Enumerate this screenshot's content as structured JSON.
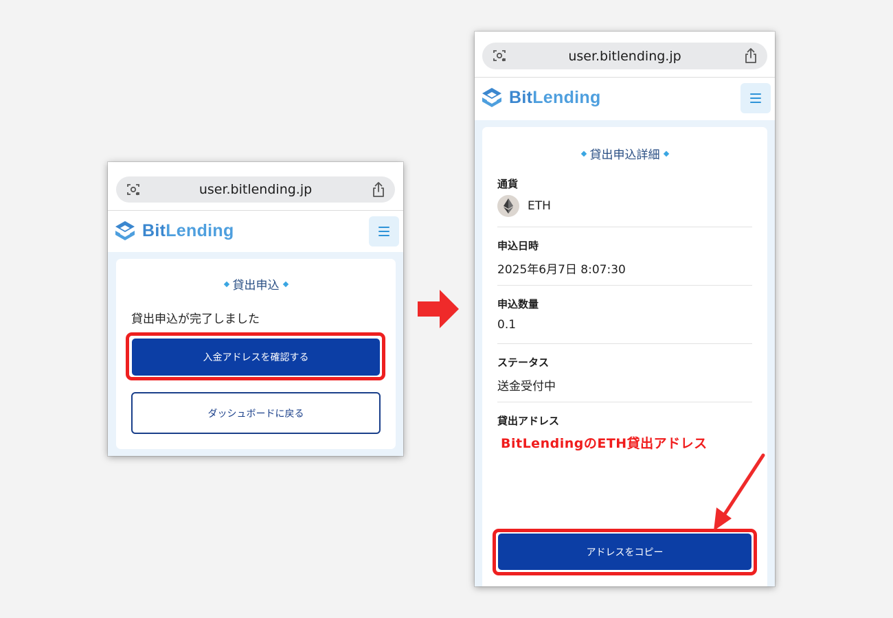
{
  "left_phone": {
    "browser": {
      "url": "user.bitlending.jp"
    },
    "header": {
      "brand_part1": "Bit",
      "brand_part2": "Lending"
    },
    "card": {
      "title": "貸出申込",
      "message": "貸出申込が完了しました",
      "primary_button": "入金アドレスを確認する",
      "secondary_button": "ダッシュボードに戻る"
    }
  },
  "right_phone": {
    "browser": {
      "url": "user.bitlending.jp"
    },
    "header": {
      "brand_part1": "Bit",
      "brand_part2": "Lending"
    },
    "card": {
      "title": "貸出申込詳細",
      "fields": [
        {
          "label": "通貨",
          "value": "ETH"
        },
        {
          "label": "申込日時",
          "value": "2025年6月7日 8:07:30"
        },
        {
          "label": "申込数量",
          "value": "0.1"
        },
        {
          "label": "ステータス",
          "value": "送金受付中"
        },
        {
          "label": "貸出アドレス",
          "value": ""
        }
      ],
      "annotation": "BitLendingのETH貸出アドレス",
      "copy_button": "アドレスをコピー"
    }
  },
  "colors": {
    "primary_button": "#0c3ea5",
    "highlight": "#ee2020",
    "brand_blue": "#3b87cf",
    "content_background": "#eaf3fb"
  }
}
